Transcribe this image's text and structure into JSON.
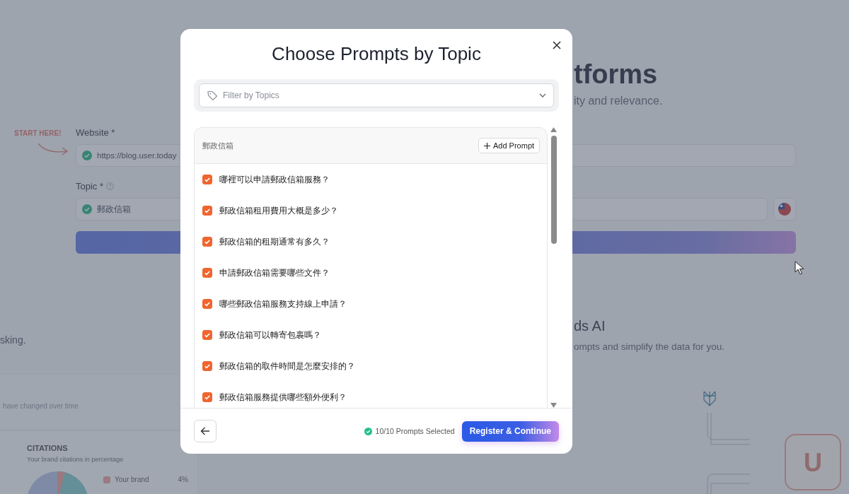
{
  "backdrop": {
    "hero": {
      "title": "tforms",
      "subtitle": "ity and relevance."
    },
    "start_hint": "START HERE!",
    "website": {
      "label": "Website *",
      "value": "https://blog.user.today",
      "valid": true
    },
    "topic": {
      "label": "Topic *",
      "value": "郵政信箱",
      "valid": true
    },
    "section": {
      "left_text": "sking.",
      "title": "ds AI",
      "subtitle": "ompts and simplify the data for you."
    },
    "trend_card": {
      "text": "have changed over time"
    },
    "citations": {
      "title": "CITATIONS",
      "subtitle": "Your brand citations in percentage",
      "legend": [
        {
          "label": "Your brand",
          "value": "4%"
        }
      ]
    },
    "diagram": {
      "logo_text": "U"
    }
  },
  "modal": {
    "title": "Choose Prompts by Topic",
    "filter": {
      "placeholder": "Filter by Topics"
    },
    "group": {
      "title": "郵政信箱",
      "add_label": "Add Prompt"
    },
    "prompts": [
      {
        "text": "哪裡可以申請郵政信箱服務？",
        "checked": true
      },
      {
        "text": "郵政信箱租用費用大概是多少？",
        "checked": true
      },
      {
        "text": "郵政信箱的租期通常有多久？",
        "checked": true
      },
      {
        "text": "申請郵政信箱需要哪些文件？",
        "checked": true
      },
      {
        "text": "哪些郵政信箱服務支持線上申請？",
        "checked": true
      },
      {
        "text": "郵政信箱可以轉寄包裹嗎？",
        "checked": true
      },
      {
        "text": "郵政信箱的取件時間是怎麼安排的？",
        "checked": true
      },
      {
        "text": "郵政信箱服務提供哪些額外便利？",
        "checked": true
      }
    ],
    "status": "10/10 Prompts Selected",
    "primary": "Register & Continue"
  }
}
